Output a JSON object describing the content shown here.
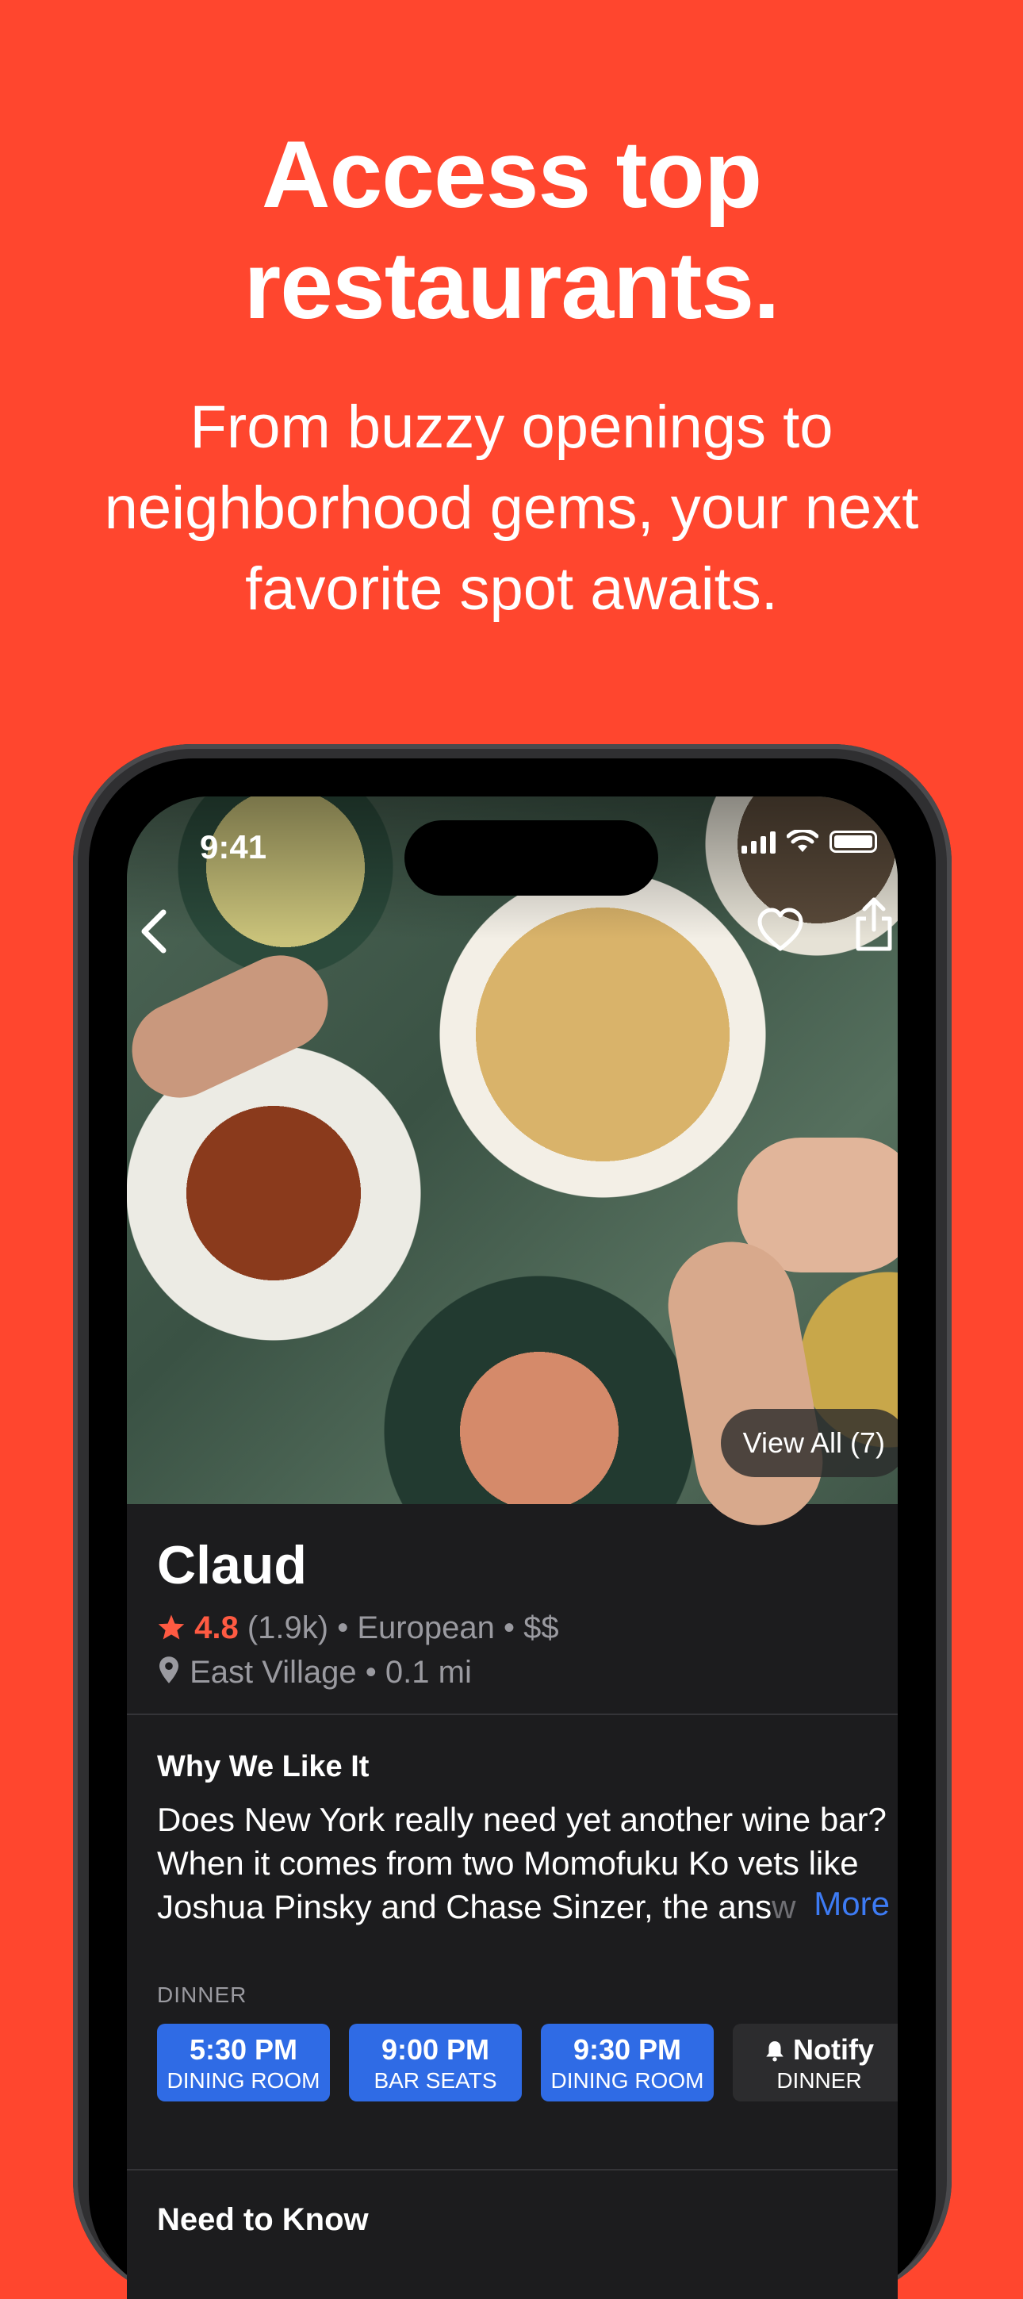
{
  "headline": {
    "line1": "Access top",
    "line2": "restaurants."
  },
  "subhead": {
    "line1": "From buzzy openings to",
    "line2": "neighborhood gems, your next",
    "line3": "favorite spot awaits."
  },
  "status_bar": {
    "time": "9:41"
  },
  "hero": {
    "view_all": "View All (7)"
  },
  "restaurant": {
    "name": "Claud",
    "rating": "4.8",
    "reviews": "(1.9k)",
    "cuisine": "European",
    "price": "$$",
    "neighborhood": "East Village",
    "distance": "0.1 mi",
    "rating_color": "#FF5A42"
  },
  "why": {
    "title": "Why We Like It",
    "text_visible": "Does New York really need yet another wine bar? When it comes from two Momofuku Ko vets like Joshua Pinsky and Chase Sinzer, the ans",
    "text_faded": "w",
    "more": "More"
  },
  "reservations": {
    "label": "DINNER",
    "slots": [
      {
        "time": "5:30 PM",
        "area": "DINING ROOM"
      },
      {
        "time": "9:00 PM",
        "area": "BAR SEATS"
      },
      {
        "time": "9:30 PM",
        "area": "DINING ROOM"
      }
    ],
    "notify": {
      "title": "Notify",
      "sub": "DINNER"
    },
    "slot_color": "#2F6BE5"
  },
  "next_section": "Need to Know",
  "icons": [
    "back-arrow-icon",
    "heart-icon",
    "share-icon",
    "star-icon",
    "location-pin-icon",
    "bell-icon",
    "cellular-signal-icon",
    "wifi-icon",
    "battery-icon"
  ],
  "colors": {
    "background": "#FF462E",
    "accent": "#3D7BF4"
  }
}
